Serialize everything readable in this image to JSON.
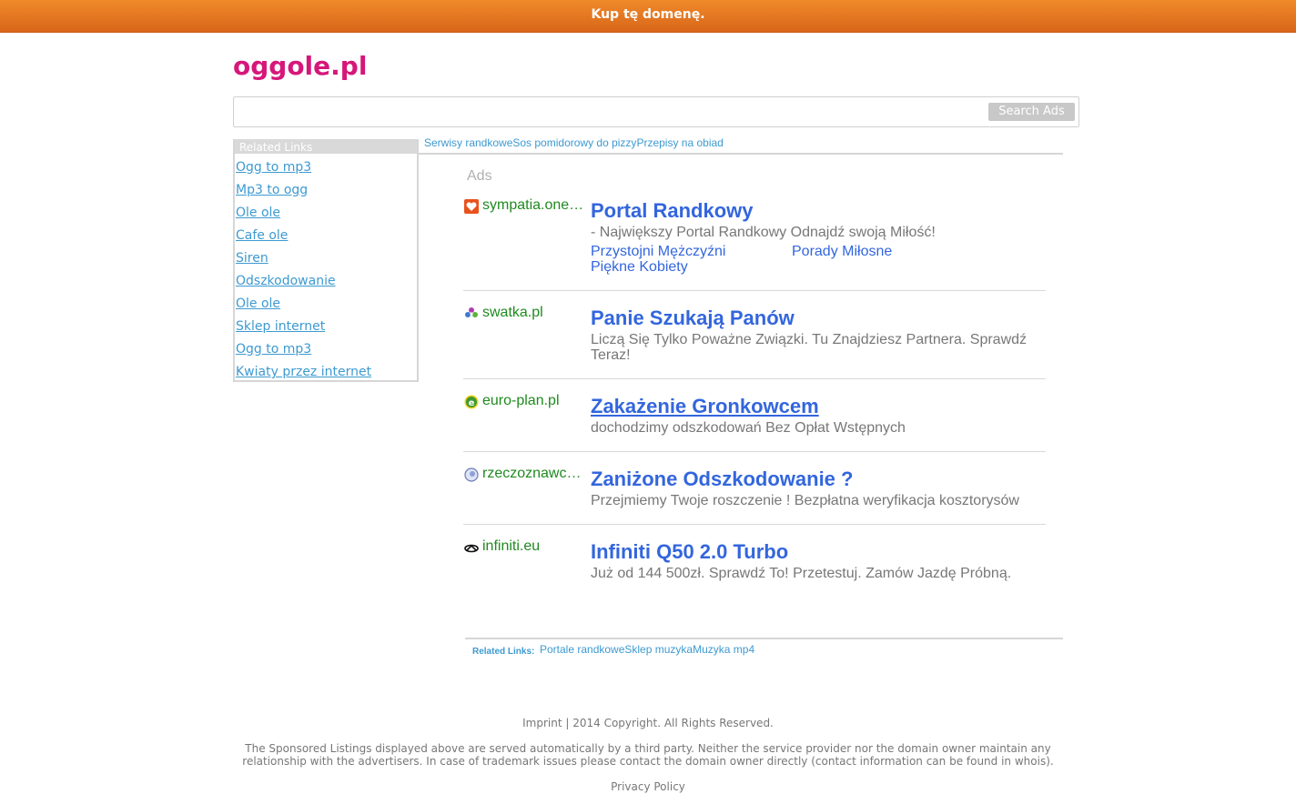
{
  "banner": {
    "label": "Kup tę domenę."
  },
  "site": {
    "title": "oggole.pl"
  },
  "search": {
    "placeholder": "",
    "button_label": "Search Ads"
  },
  "related_sidebar": {
    "header": "Related Links",
    "items": [
      {
        "label": "Ogg to mp3"
      },
      {
        "label": "Mp3 to ogg"
      },
      {
        "label": "Ole ole"
      },
      {
        "label": "Cafe ole"
      },
      {
        "label": "Siren"
      },
      {
        "label": "Odszkodowanie"
      },
      {
        "label": "Ole ole"
      },
      {
        "label": "Sklep internet"
      },
      {
        "label": "Ogg to mp3"
      },
      {
        "label": "Kwiaty przez internet"
      }
    ]
  },
  "top_links": [
    {
      "label": "Serwisy randkowe"
    },
    {
      "label": "Sos pomidorowy do pizzy"
    },
    {
      "label": "Przepisy na obiad"
    }
  ],
  "ads": {
    "label": "Ads",
    "items": [
      {
        "domain": "sympatia.onet.pl",
        "favicon": "heart-favicon",
        "title": "Portal Randkowy",
        "description": "- Największy Portal Randkowy Odnajdź swoją Miłość!",
        "sitelinks": [
          {
            "label": "Przystojni Mężczyźni"
          },
          {
            "label": "Porady Miłosne"
          },
          {
            "label": "Piękne Kobiety"
          }
        ]
      },
      {
        "domain": "swatka.pl",
        "favicon": "flower-favicon",
        "title": "Panie Szukają Panów",
        "description": "Liczą Się Tylko Poważne Związki. Tu Znajdziesz Partnera. Sprawdź Teraz!"
      },
      {
        "domain": "euro-plan.pl",
        "favicon": "e-circle-favicon",
        "title": "Zakażenie Gronkowcem",
        "description": "dochodzimy odszkodowań Bez Opłat Wstępnych"
      },
      {
        "domain": "rzeczoznawca.pl",
        "favicon": "globe-favicon",
        "title": "Zaniżone Odszkodowanie ?",
        "description": "Przejmiemy Twoje roszczenie ! Bezpłatna weryfikacja kosztorysów"
      },
      {
        "domain": "infiniti.eu",
        "favicon": "infiniti-logo-favicon",
        "title": "Infiniti Q50 2.0 Turbo",
        "description": "Już od 144 500zł. Sprawdź To! Przetestuj. Zamów Jazdę Próbną."
      }
    ]
  },
  "bottom_related": {
    "label": "Related Links:",
    "items": [
      {
        "label": "Portale randkowe"
      },
      {
        "label": "Sklep muzyka"
      },
      {
        "label": "Muzyka mp4"
      }
    ]
  },
  "footer": {
    "imprint": "Imprint",
    "copyright": " | 2014 Copyright. All Rights Reserved.",
    "disclaimer_line1": "The Sponsored Listings displayed above are served automatically by a third party. Neither the service provider nor the domain owner maintain any",
    "disclaimer_line2": "relationship with the advertisers. In case of trademark issues please contact the domain owner directly (contact information can be found in whois).",
    "privacy": "Privacy Policy"
  },
  "colors": {
    "banner": "#e8781f",
    "logo": "#d6177a",
    "ad_title": "#3366dd",
    "ad_domain": "#1f8a1f",
    "link": "#3d9ad1"
  }
}
